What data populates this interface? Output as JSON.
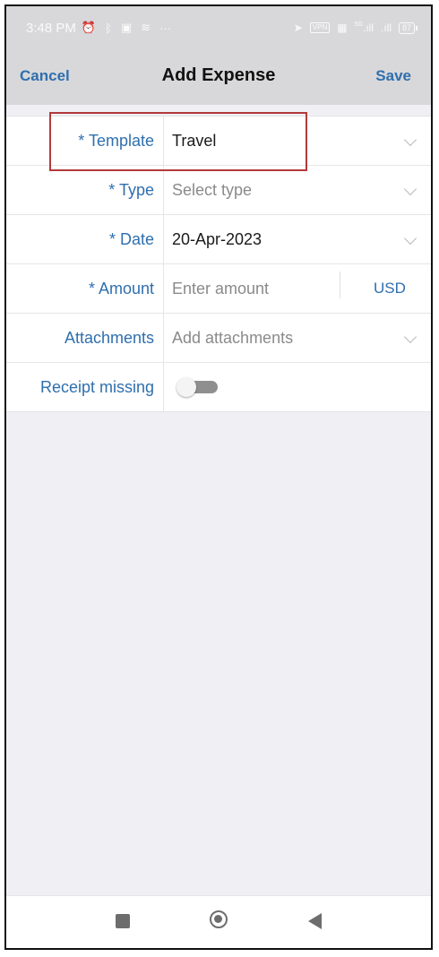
{
  "status_bar": {
    "time": "3:48 PM",
    "left_icons": [
      "alarm-icon",
      "bluetooth-icon",
      "message-icon",
      "signal-off-icon",
      "more-icon"
    ],
    "vpn_label": "VPN",
    "network_label": "5G",
    "battery": "87"
  },
  "header": {
    "cancel_label": "Cancel",
    "title": "Add Expense",
    "save_label": "Save"
  },
  "form": {
    "template": {
      "label": "* Template",
      "value": "Travel"
    },
    "type": {
      "label": "* Type",
      "placeholder": "Select type"
    },
    "date": {
      "label": "* Date",
      "value": "20-Apr-2023"
    },
    "amount": {
      "label": "* Amount",
      "placeholder": "Enter amount",
      "currency": "USD"
    },
    "attachments": {
      "label": "Attachments",
      "placeholder": "Add attachments"
    },
    "receipt_missing": {
      "label": "Receipt missing",
      "on": false
    }
  },
  "colors": {
    "accent": "#2f6fae",
    "header_bg": "#d8d8da",
    "highlight": "#b33a3a"
  },
  "bottom_nav": [
    "recent-apps-icon",
    "home-icon",
    "back-icon"
  ]
}
